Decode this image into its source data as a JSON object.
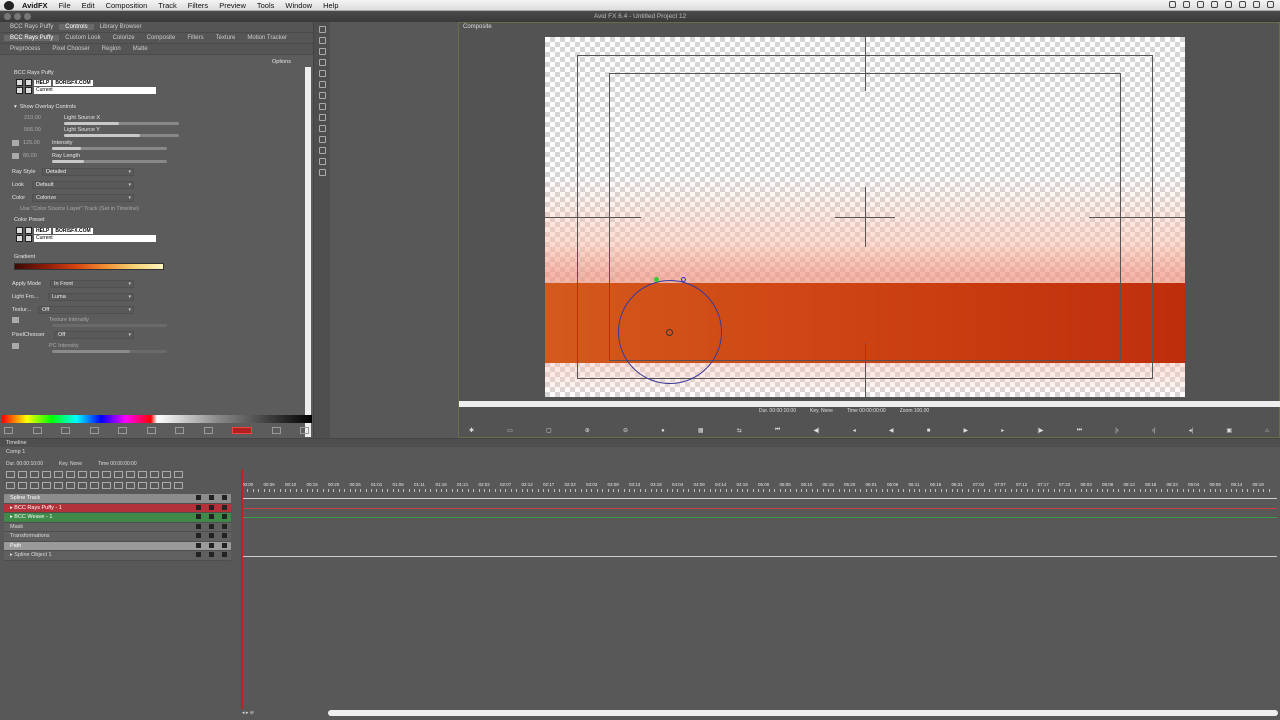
{
  "menubar": {
    "app": "AvidFX",
    "items": [
      "File",
      "Edit",
      "Composition",
      "Track",
      "Filters",
      "Preview",
      "Tools",
      "Window",
      "Help"
    ]
  },
  "window": {
    "title": "Avid FX 6.4 - Untitled Project 12"
  },
  "left_tabs_row1": [
    "BCC Rays Puffy",
    "Controls",
    "Library Browser"
  ],
  "left_tabs_row2": [
    "BCC Rays Puffy",
    "Custom Look",
    "Colorize",
    "Composite",
    "Filters",
    "Texture",
    "Motion Tracker"
  ],
  "left_tabs_row3": [
    "Preprocess",
    "Pixel Chooser",
    "Region",
    "Matte"
  ],
  "controls": {
    "options": "Options",
    "effect_name": "BCC Rays Puffy",
    "preset_help": "HELP",
    "preset_logo": "BORISFX.COM",
    "preset_value": "Current",
    "show_overlay": "Show Overlay Controls",
    "light_x_value": "210.00",
    "light_x_label": "Light Source X",
    "light_y_value": "566.00",
    "light_y_label": "Light Source Y",
    "intensity_value": "125.00",
    "intensity_label": "Intensity",
    "ray_length_value": "80.00",
    "ray_length_label": "Ray Length",
    "ray_style_label": "Ray Style",
    "ray_style_value": "Detailed",
    "look_label": "Look",
    "look_value": "Default",
    "color_label": "Color",
    "color_value": "Colorize",
    "use_color_source": "Use \"Color Source Layer\" Track (Set in Timeline)",
    "color_preset": "Color Preset",
    "color_preset_value": "Current",
    "gradient_label": "Gradient",
    "apply_mode_label": "Apply Mode",
    "apply_mode_value": "In Front",
    "light_from_label": "Light Fro...",
    "light_from_value": "Luma",
    "texture_label": "Textur...",
    "texture_value": "Off",
    "texture_intensity": "Texture Intensity",
    "pixelchooser_label": "PixelChooser",
    "pixelchooser_value": "Off",
    "pc_intensity": "PC Intensity"
  },
  "composite": {
    "tab": "Composite",
    "dur": "Dur. 00:00:10:00",
    "key": "Key. None",
    "time": "Time 00:00:00:00",
    "zoom": "Zoom 100.00"
  },
  "timeline": {
    "title": "Timeline",
    "comp": "Comp 1",
    "dur": "Dur. 00:00:10:00",
    "key": "Key.",
    "key_value": "None",
    "time": "Time 00:00:00:00",
    "tracks": [
      {
        "name": "Spline Track",
        "style": "t-spline"
      },
      {
        "name": "BCC Rays Puffy - 1",
        "style": "t-red"
      },
      {
        "name": "BCC Weave - 1",
        "style": "t-green"
      },
      {
        "name": "Mask",
        "style": "t-gray"
      },
      {
        "name": "Transformations",
        "style": "t-gray"
      },
      {
        "name": "Path",
        "style": "t-path"
      },
      {
        "name": "Spline Object 1",
        "style": "t-gray"
      }
    ],
    "ruler": [
      "00:00",
      "00:05",
      "00:10",
      "00:15",
      "00:20",
      "00:25",
      "01:01",
      "01:06",
      "01:11",
      "01:16",
      "01:21",
      "02:02",
      "02:07",
      "02:12",
      "02:17",
      "02:22",
      "03:03",
      "03:08",
      "03:13",
      "03:18",
      "04:04",
      "04:09",
      "04:14",
      "04:19",
      "05:00",
      "05:05",
      "05:10",
      "05:15",
      "05:20",
      "06:01",
      "06:06",
      "06:11",
      "06:16",
      "06:21",
      "07:02",
      "07:07",
      "07:12",
      "07:17",
      "07:22",
      "08:03",
      "08:08",
      "08:13",
      "08:18",
      "08:23",
      "09:04",
      "09:09",
      "09:14",
      "09:19"
    ]
  }
}
